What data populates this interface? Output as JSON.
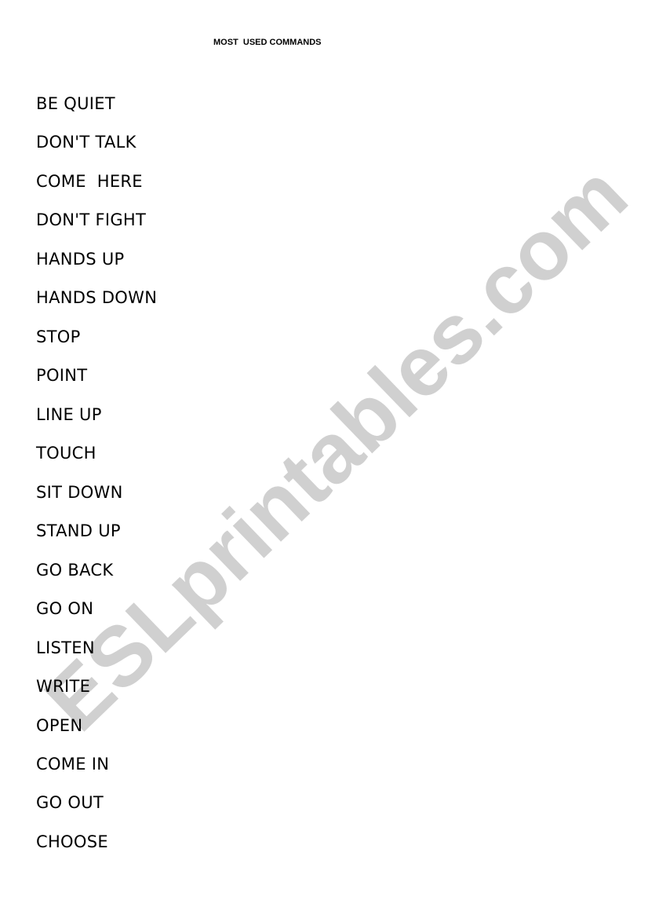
{
  "title": "MOST  USED COMMANDS",
  "commands": [
    "BE QUIET",
    "DON'T TALK",
    "COME  HERE",
    "DON'T FIGHT",
    "HANDS UP",
    "HANDS DOWN",
    "STOP",
    "POINT",
    "LINE UP",
    "TOUCH",
    "SIT DOWN",
    "STAND UP",
    "GO BACK",
    "GO ON",
    "LISTEN",
    "WRITE",
    "OPEN",
    "COME IN",
    "GO OUT",
    "CHOOSE"
  ],
  "watermark": "ESLprintables.com",
  "colors": {
    "text": "#000000",
    "watermark": "#c8c8c8"
  }
}
